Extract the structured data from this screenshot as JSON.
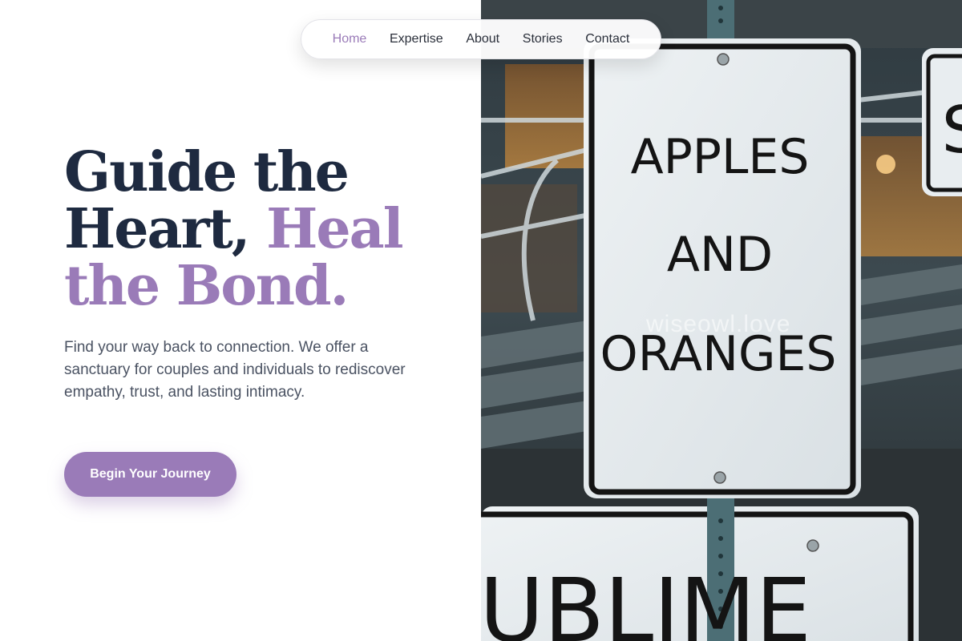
{
  "nav": {
    "items": [
      {
        "label": "Home",
        "active": true
      },
      {
        "label": "Expertise",
        "active": false
      },
      {
        "label": "About",
        "active": false
      },
      {
        "label": "Stories",
        "active": false
      },
      {
        "label": "Contact",
        "active": false
      }
    ]
  },
  "hero": {
    "headline": {
      "line1": "Guide the",
      "line2_plain": "Heart, ",
      "line2_accent": "Heal",
      "line3_accent": "the Bond."
    },
    "subcopy": "Find your way back to connection. We offer a sanctuary for couples and individuals to rediscover empathy, trust, and lasting intimacy.",
    "cta_label": "Begin Your Journey"
  },
  "image": {
    "sign_main": {
      "line1": "APPLES",
      "line2": "AND",
      "line3": "ORANGES"
    },
    "sign_lower": "UBLIME",
    "sign_right_partial": "S",
    "watermark": "wiseowl.love"
  },
  "colors": {
    "accent": "#9a7bb8",
    "heading": "#1e2a40",
    "body_text": "#4a5262"
  }
}
